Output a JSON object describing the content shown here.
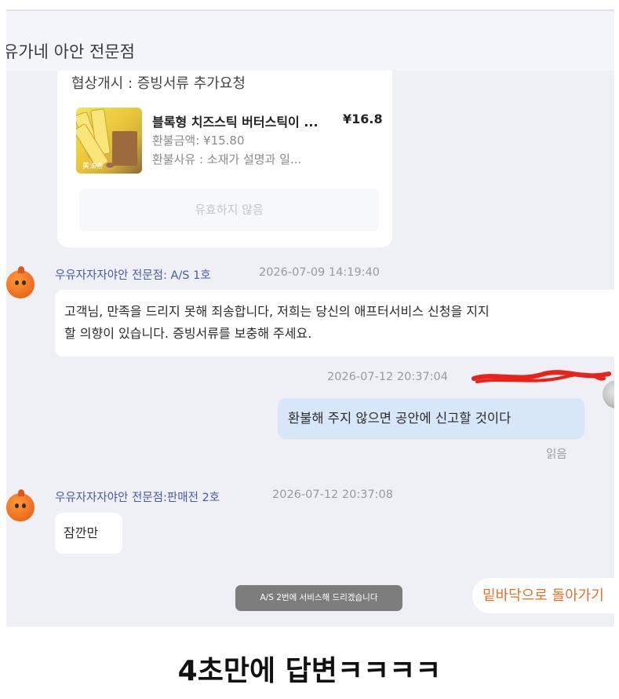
{
  "header": {
    "shop_title": "유가네 아안 전문점"
  },
  "order_card": {
    "negotiation_text": "협상개시 : 증빙서류 추가요청",
    "product_name": "블록형 치즈스틱 버터스틱이 ...",
    "product_price": "¥16.8",
    "refund_amount": "환불금액: ¥15.80",
    "refund_reason": "환불사유 : 소재가 설명과 일...",
    "invalid_label": "유효하지 않음",
    "thumb_text": "黄油条 🍩"
  },
  "messages": [
    {
      "sender": "우유자자자야안 전문점: A/S 1호",
      "time": "2026-07-09 14:19:40",
      "line1": "고객님, 만족을 드리지 못해 죄송합니다, 저희는 당신의 애프터서비스 신청을 지지",
      "line2": "할 의향이 있습니다. 증빙서류를 보충해 주세요."
    },
    {
      "time": "2026-07-12 20:37:04",
      "text": "환불해 주지 않으면 공안에 신고할 것이다",
      "status": "읽음"
    },
    {
      "sender": "우유자자자야안 전문점:판매전 2호",
      "time": "2026-07-12 20:37:08",
      "text": "잠깐만"
    }
  ],
  "toast": "A/S 2번에 서비스해 드리겠습니다",
  "scroll_bottom_label": "밑바닥으로 돌아가기",
  "caption": "4초만에 답변ㅋㅋㅋㅋ",
  "colors": {
    "chat_background": "#eef0f6",
    "my_bubble": "#d8e7f8",
    "sender_name": "#4a5aa0",
    "accent_orange": "#e0702a",
    "redaction": "#e8231c"
  }
}
